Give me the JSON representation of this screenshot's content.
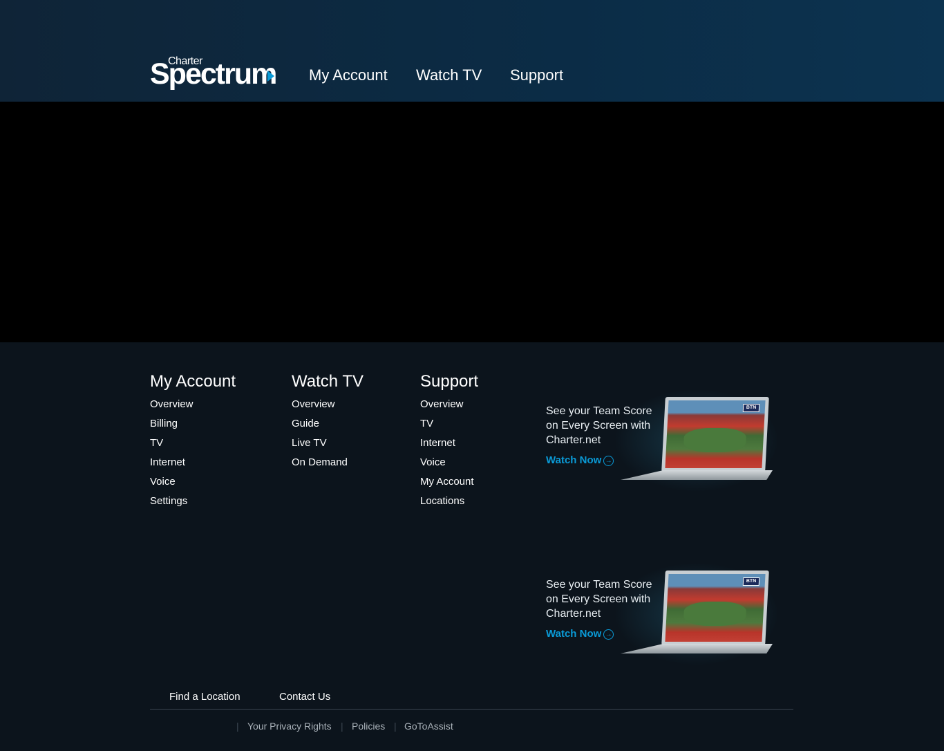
{
  "header": {
    "logo": {
      "small": "Charter",
      "big": "Spectrum"
    },
    "nav": [
      "My Account",
      "Watch TV",
      "Support"
    ]
  },
  "footer": {
    "columns": [
      {
        "heading": "My Account",
        "links": [
          "Overview",
          "Billing",
          "TV",
          "Internet",
          "Voice",
          "Settings"
        ]
      },
      {
        "heading": "Watch TV",
        "links": [
          "Overview",
          "Guide",
          "Live TV",
          "On Demand"
        ]
      },
      {
        "heading": "Support",
        "links": [
          "Overview",
          "TV",
          "Internet",
          "Voice",
          "My Account",
          "Locations"
        ]
      }
    ],
    "promos": [
      {
        "text": "See your Team Score on Every Screen with Charter.net",
        "link": "Watch Now",
        "badge": "BTN"
      },
      {
        "text": "See your Team Score on Every Screen with Charter.net",
        "link": "Watch Now",
        "badge": "BTN"
      }
    ],
    "bottom_links": [
      "Find a Location",
      "Contact Us"
    ],
    "legal_links": [
      "Your Privacy Rights",
      "Policies",
      "GoToAssist"
    ]
  },
  "colors": {
    "header_start": "#0f2437",
    "header_end": "#0c3350",
    "accent": "#0a9bd8",
    "footer_bg": "#0c141c"
  }
}
